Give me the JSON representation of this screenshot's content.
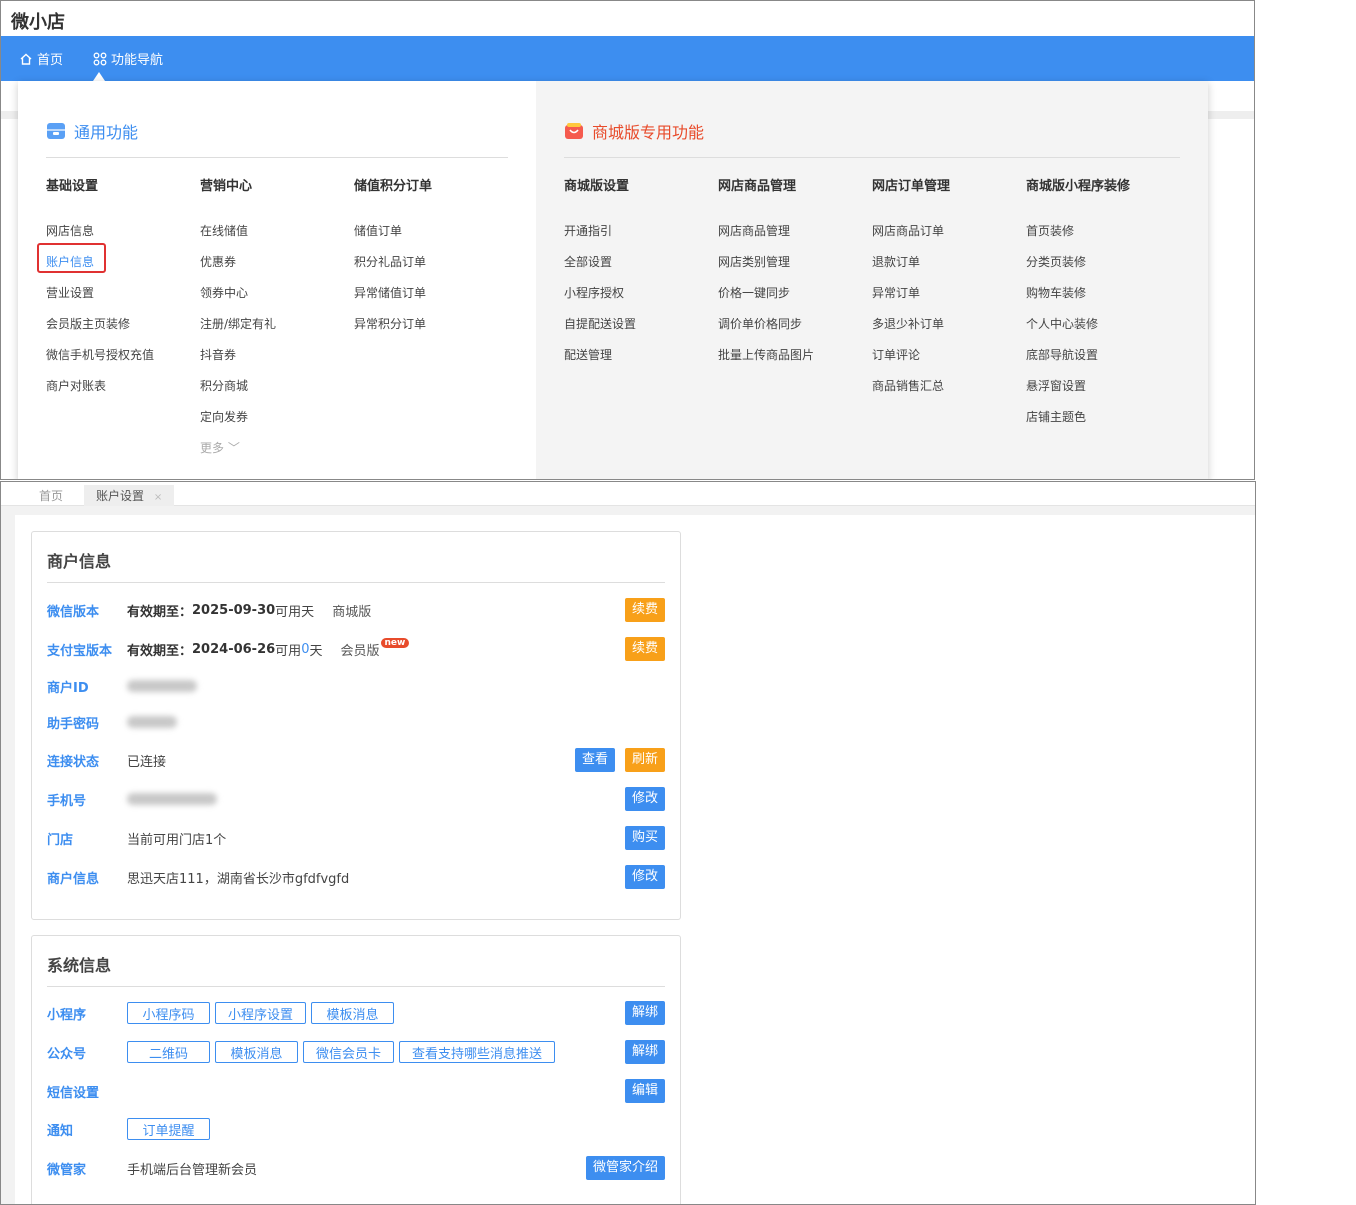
{
  "app_title": "微小店",
  "nav": {
    "home": "首页",
    "function_nav": "功能导航"
  },
  "general": {
    "title": "通用功能",
    "columns": [
      {
        "title": "基础设置",
        "items": [
          "网店信息",
          "账户信息",
          "营业设置",
          "会员版主页装修",
          "微信手机号授权充值",
          "商户对账表"
        ]
      },
      {
        "title": "营销中心",
        "items": [
          "在线储值",
          "优惠券",
          "领券中心",
          "注册/绑定有礼",
          "抖音券",
          "积分商城",
          "定向发券",
          "更多"
        ]
      },
      {
        "title": "储值积分订单",
        "items": [
          "储值订单",
          "积分礼品订单",
          "异常储值订单",
          "异常积分订单"
        ]
      }
    ]
  },
  "mall": {
    "title": "商城版专用功能",
    "columns": [
      {
        "title": "商城版设置",
        "items": [
          "开通指引",
          "全部设置",
          "小程序授权",
          "自提配送设置",
          "配送管理"
        ]
      },
      {
        "title": "网店商品管理",
        "items": [
          "网店商品管理",
          "网店类别管理",
          "价格一键同步",
          "调价单价格同步",
          "批量上传商品图片"
        ]
      },
      {
        "title": "网店订单管理",
        "items": [
          "网店商品订单",
          "退款订单",
          "异常订单",
          "多退少补订单",
          "订单评论",
          "商品销售汇总"
        ]
      },
      {
        "title": "商城版小程序装修",
        "items": [
          "首页装修",
          "分类页装修",
          "购物车装修",
          "个人中心装修",
          "底部导航设置",
          "悬浮窗设置",
          "店铺主题色"
        ]
      }
    ]
  },
  "tabs": {
    "home": "首页",
    "account": "账户设置",
    "close": "×"
  },
  "merchant": {
    "title": "商户信息",
    "wechat": {
      "label": "微信版本",
      "validity_label": "有效期至：",
      "date": "2025-09-30",
      "avail": "可用天",
      "edition": "商城版",
      "btn": "续费"
    },
    "alipay": {
      "label": "支付宝版本",
      "validity_label": "有效期至：",
      "date": "2024-06-26",
      "avail_pre": "可用",
      "days": "0",
      "avail_post": "天",
      "edition": "会员版",
      "badge": "new",
      "btn": "续费"
    },
    "merchant_id": {
      "label": "商户ID"
    },
    "helper_pwd": {
      "label": "助手密码"
    },
    "conn": {
      "label": "连接状态",
      "value": "已连接",
      "btn_view": "查看",
      "btn_refresh": "刷新"
    },
    "phone": {
      "label": "手机号",
      "btn": "修改"
    },
    "store": {
      "label": "门店",
      "value": "当前可用门店1个",
      "btn": "购买"
    },
    "info": {
      "label": "商户信息",
      "value": "思迅天店111，湖南省长沙市gfdfvgfd",
      "btn": "修改"
    }
  },
  "system": {
    "title": "系统信息",
    "mini": {
      "label": "小程序",
      "links": [
        "小程序码",
        "小程序设置",
        "模板消息"
      ],
      "btn": "解绑"
    },
    "mp": {
      "label": "公众号",
      "links": [
        "二维码",
        "模板消息",
        "微信会员卡",
        "查看支持哪些消息推送"
      ],
      "btn": "解绑"
    },
    "sms": {
      "label": "短信设置",
      "btn": "编辑"
    },
    "notify": {
      "label": "通知",
      "links": [
        "订单提醒"
      ]
    },
    "wgj": {
      "label": "微管家",
      "value": "手机端后台管理新会员",
      "btn": "微管家介绍"
    }
  },
  "colors": {
    "accent": "#3d8ef0",
    "orange": "#f8a019",
    "red": "#e03131"
  }
}
